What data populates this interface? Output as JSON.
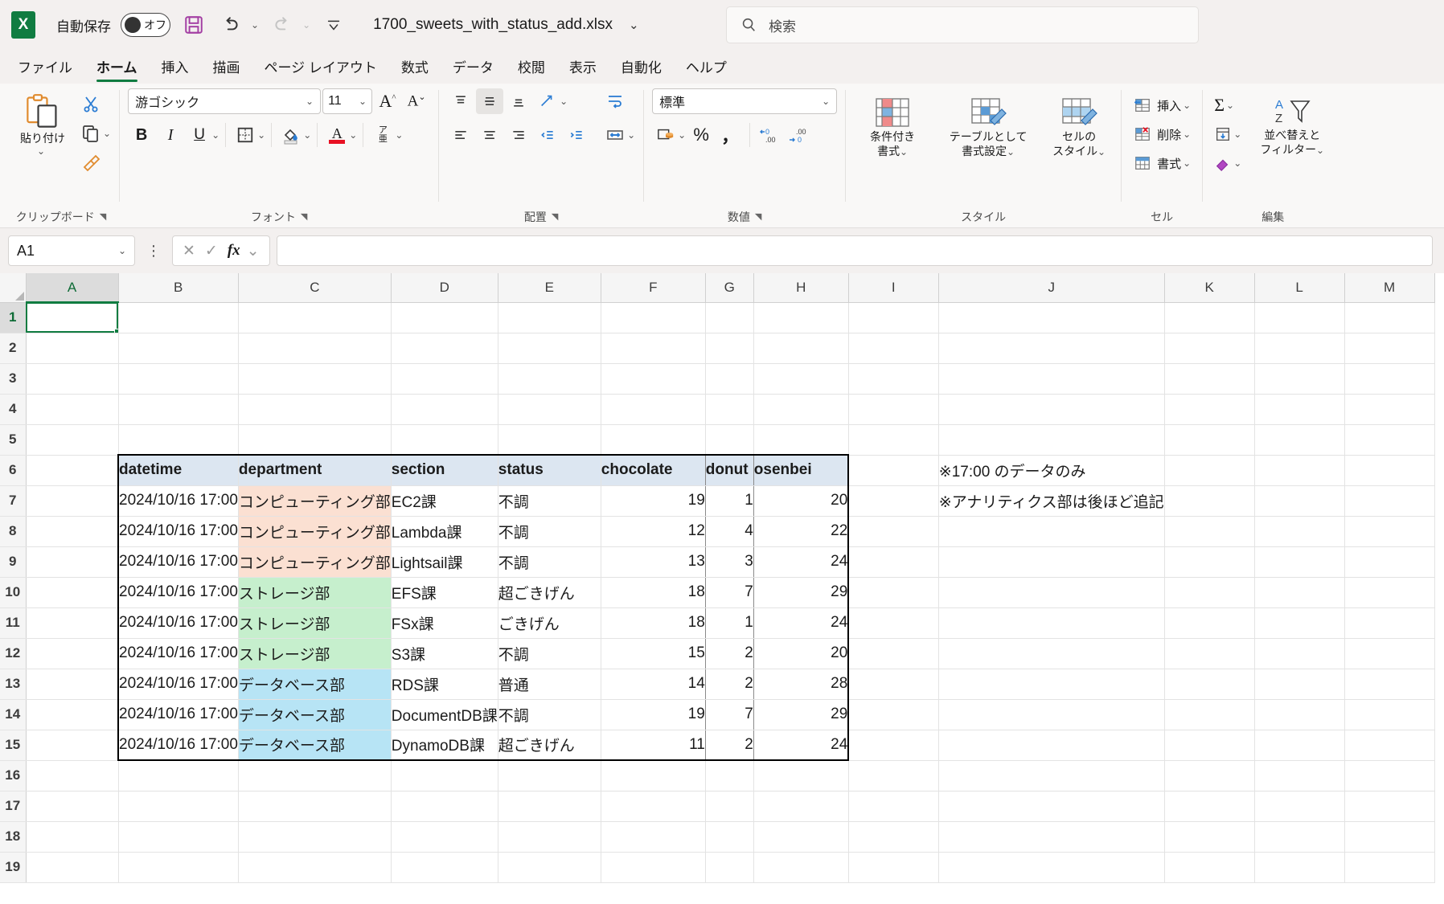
{
  "titlebar": {
    "app_icon": "excel-logo",
    "autosave_label": "自動保存",
    "autosave_state": "オフ",
    "doc_title": "1700_sweets_with_status_add.xlsx",
    "save_icon": "save-icon",
    "undo_icon": "undo-icon",
    "redo_icon": "redo-icon",
    "customize_icon": "customize-quick-access-icon"
  },
  "search": {
    "placeholder": "検索",
    "icon": "search-icon"
  },
  "tabs": [
    {
      "label": "ファイル",
      "active": false
    },
    {
      "label": "ホーム",
      "active": true
    },
    {
      "label": "挿入",
      "active": false
    },
    {
      "label": "描画",
      "active": false
    },
    {
      "label": "ページ レイアウト",
      "active": false
    },
    {
      "label": "数式",
      "active": false
    },
    {
      "label": "データ",
      "active": false
    },
    {
      "label": "校閲",
      "active": false
    },
    {
      "label": "表示",
      "active": false
    },
    {
      "label": "自動化",
      "active": false
    },
    {
      "label": "ヘルプ",
      "active": false
    }
  ],
  "ribbon": {
    "clipboard": {
      "label": "クリップボード",
      "paste_label": "貼り付け",
      "cut_icon": "scissors-icon",
      "copy_icon": "copy-icon",
      "format_painter_icon": "format-painter-icon"
    },
    "font": {
      "label": "フォント",
      "font_name": "游ゴシック",
      "font_size": "11",
      "grow_icon": "increase-font-size-icon",
      "shrink_icon": "decrease-font-size-icon",
      "bold_label": "B",
      "italic_label": "I",
      "underline_label": "U",
      "border_icon": "borders-icon",
      "fill_icon": "fill-color-icon",
      "fontcolor_label": "A",
      "phonetic_icon": "phonetic-guide-icon"
    },
    "alignment": {
      "label": "配置",
      "align_top_icon": "align-top-icon",
      "align_middle_icon": "align-middle-icon",
      "align_bottom_icon": "align-bottom-icon",
      "orientation_icon": "text-orientation-icon",
      "align_left_icon": "align-left-icon",
      "align_center_icon": "align-center-icon",
      "align_right_icon": "align-right-icon",
      "decrease_indent_icon": "decrease-indent-icon",
      "increase_indent_icon": "increase-indent-icon",
      "wrap_text_icon": "wrap-text-icon",
      "merge_icon": "merge-and-center-icon"
    },
    "number": {
      "label": "数値",
      "format": "標準",
      "accounting_icon": "accounting-format-icon",
      "percent_label": "%",
      "comma_label": "，",
      "decrease_decimal_icon": "decrease-decimal-icon",
      "increase_decimal_icon": "increase-decimal-icon"
    },
    "styles": {
      "label": "スタイル",
      "conditional_l1": "条件付き",
      "conditional_l2": "書式",
      "table_l1": "テーブルとして",
      "table_l2": "書式設定",
      "cellstyle_l1": "セルの",
      "cellstyle_l2": "スタイル"
    },
    "cells": {
      "label": "セル",
      "insert_label": "挿入",
      "delete_label": "削除",
      "format_label": "書式",
      "insert_icon": "insert-cells-icon",
      "delete_icon": "delete-cells-icon",
      "format_icon": "format-cells-icon"
    },
    "editing": {
      "label": "編集",
      "autosum_icon": "autosum-icon",
      "fill_icon": "fill-down-icon",
      "clear_icon": "clear-icon",
      "sortfilter_l1": "並べ替えと",
      "sortfilter_l2": "フィルター",
      "sortfilter_icon": "sort-and-filter-icon"
    }
  },
  "formula_bar": {
    "name_box": "A1",
    "cancel_icon": "cancel-icon",
    "enter_icon": "confirm-icon",
    "fx_label": "fx",
    "formula_value": ""
  },
  "grid": {
    "columns": [
      "A",
      "B",
      "C",
      "D",
      "E",
      "F",
      "G",
      "H",
      "I",
      "J",
      "K",
      "L",
      "M"
    ],
    "selected_cell": "A1",
    "rows": [
      "1",
      "2",
      "3",
      "4",
      "5",
      "6",
      "7",
      "8",
      "9",
      "10",
      "11",
      "12",
      "13",
      "14",
      "15",
      "16",
      "17",
      "18",
      "19"
    ],
    "table_headers": [
      "datetime",
      "department",
      "section",
      "status",
      "chocolate",
      "donut",
      "osenbei"
    ],
    "table_rows": [
      {
        "datetime": "2024/10/16 17:00",
        "department": "コンピューティング部",
        "section": "EC2課",
        "status": "不調",
        "chocolate": "19",
        "donut": "1",
        "osenbei": "20",
        "dept_color": "#fbe0d2"
      },
      {
        "datetime": "2024/10/16 17:00",
        "department": "コンピューティング部",
        "section": "Lambda課",
        "status": "不調",
        "chocolate": "12",
        "donut": "4",
        "osenbei": "22",
        "dept_color": "#fbe0d2"
      },
      {
        "datetime": "2024/10/16 17:00",
        "department": "コンピューティング部",
        "section": "Lightsail課",
        "status": "不調",
        "chocolate": "13",
        "donut": "3",
        "osenbei": "24",
        "dept_color": "#fbe0d2"
      },
      {
        "datetime": "2024/10/16 17:00",
        "department": "ストレージ部",
        "section": "EFS課",
        "status": "超ごきげん",
        "chocolate": "18",
        "donut": "7",
        "osenbei": "29",
        "dept_color": "#c6efcd"
      },
      {
        "datetime": "2024/10/16 17:00",
        "department": "ストレージ部",
        "section": "FSx課",
        "status": "ごきげん",
        "chocolate": "18",
        "donut": "1",
        "osenbei": "24",
        "dept_color": "#c6efcd"
      },
      {
        "datetime": "2024/10/16 17:00",
        "department": "ストレージ部",
        "section": "S3課",
        "status": "不調",
        "chocolate": "15",
        "donut": "2",
        "osenbei": "20",
        "dept_color": "#c6efcd"
      },
      {
        "datetime": "2024/10/16 17:00",
        "department": "データベース部",
        "section": "RDS課",
        "status": "普通",
        "chocolate": "14",
        "donut": "2",
        "osenbei": "28",
        "dept_color": "#b7e4f5"
      },
      {
        "datetime": "2024/10/16 17:00",
        "department": "データベース部",
        "section": "DocumentDB課",
        "status": "不調",
        "chocolate": "19",
        "donut": "7",
        "osenbei": "29",
        "dept_color": "#b7e4f5"
      },
      {
        "datetime": "2024/10/16 17:00",
        "department": "データベース部",
        "section": "DynamoDB課",
        "status": "超ごきげん",
        "chocolate": "11",
        "donut": "2",
        "osenbei": "24",
        "dept_color": "#b7e4f5"
      }
    ],
    "notes": [
      "※17:00 のデータのみ",
      "※アナリティクス部は後ほど追記"
    ],
    "header_fill": "#dce6f1",
    "accent_color": "#107c41"
  }
}
